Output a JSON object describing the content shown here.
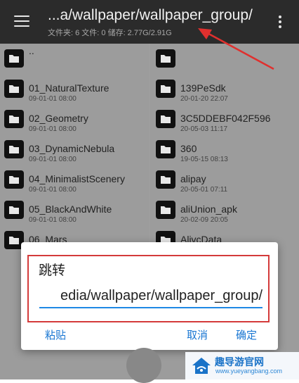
{
  "header": {
    "path": "...a/wallpaper/wallpaper_group/",
    "info": "文件夹: 6  文件: 0  储存: 2.77G/2.91G"
  },
  "left_items": [
    {
      "name": "..",
      "date": ""
    },
    {
      "name": "01_NaturalTexture",
      "date": "09-01-01 08:00"
    },
    {
      "name": "02_Geometry",
      "date": "09-01-01 08:00"
    },
    {
      "name": "03_DynamicNebula",
      "date": "09-01-01 08:00"
    },
    {
      "name": "04_MinimalistScenery",
      "date": "09-01-01 08:00"
    },
    {
      "name": "05_BlackAndWhite",
      "date": "09-01-01 08:00"
    },
    {
      "name": "06_Mars",
      "date": ""
    }
  ],
  "right_items": [
    {
      "name": "",
      "date": ""
    },
    {
      "name": "139PeSdk",
      "date": "20-01-20 22:07"
    },
    {
      "name": "3C5DDEBF042F596",
      "date": "20-05-03 11:17"
    },
    {
      "name": "360",
      "date": "19-05-15 08:13"
    },
    {
      "name": "alipay",
      "date": "20-05-01 07:11"
    },
    {
      "name": "aliUnion_apk",
      "date": "20-02-09 20:05"
    },
    {
      "name": "AlivcData",
      "date": ""
    }
  ],
  "dialog": {
    "title": "跳转",
    "input_value": "edia/wallpaper/wallpaper_group/",
    "paste": "粘贴",
    "cancel": "取消",
    "ok": "确定"
  },
  "watermark": {
    "text": "趣导游官网",
    "sub": "www.yueyangbang.com"
  },
  "colors": {
    "topbar": "#2b2b2b",
    "accent": "#1976d2",
    "highlight_box": "#d43b3b"
  },
  "icons": [
    "menu-icon",
    "more-vert-icon",
    "folder-icon",
    "annotation-arrow"
  ]
}
